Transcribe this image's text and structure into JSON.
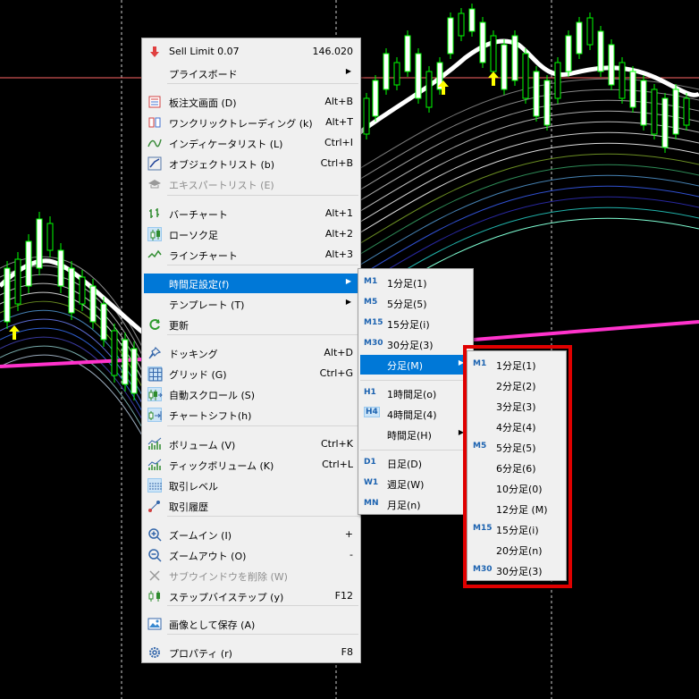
{
  "context_menu": {
    "header": {
      "label": "Sell Limit 0.07",
      "value": "146.020",
      "icon": "sell-arrow-icon"
    },
    "items": [
      {
        "label": "プライスボード",
        "shortcut": "",
        "arrow": true,
        "icon": "",
        "disabled": false
      },
      {
        "label": "板注文画面 (D)",
        "shortcut": "Alt+B",
        "icon": "depth-of-market-icon"
      },
      {
        "label": "ワンクリックトレーディング (k)",
        "shortcut": "Alt+T",
        "icon": "one-click-trading-icon"
      },
      {
        "label": "インディケータリスト (L)",
        "shortcut": "Ctrl+I",
        "icon": "indicator-list-icon"
      },
      {
        "label": "オブジェクトリスト (b)",
        "shortcut": "Ctrl+B",
        "icon": "object-list-icon"
      },
      {
        "label": "エキスパートリスト (E)",
        "shortcut": "",
        "icon": "expert-hat-icon",
        "disabled": true
      },
      {
        "label": "バーチャート",
        "shortcut": "Alt+1",
        "icon": "bar-chart-icon"
      },
      {
        "label": "ローソク足",
        "shortcut": "Alt+2",
        "icon": "candlestick-icon"
      },
      {
        "label": "ラインチャート",
        "shortcut": "Alt+3",
        "icon": "line-chart-icon"
      },
      {
        "label": "時間足設定(f)",
        "shortcut": "",
        "arrow": true,
        "icon": "",
        "highlighted": true
      },
      {
        "label": "テンプレート (T)",
        "shortcut": "",
        "arrow": true,
        "icon": ""
      },
      {
        "label": "更新",
        "shortcut": "",
        "icon": "refresh-icon"
      },
      {
        "label": "ドッキング",
        "shortcut": "Alt+D",
        "icon": "pin-icon"
      },
      {
        "label": "グリッド (G)",
        "shortcut": "Ctrl+G",
        "icon": "grid-icon"
      },
      {
        "label": "自動スクロール (S)",
        "shortcut": "",
        "icon": "auto-scroll-icon"
      },
      {
        "label": "チャートシフト(h)",
        "shortcut": "",
        "icon": "chart-shift-icon"
      },
      {
        "label": "ボリューム (V)",
        "shortcut": "Ctrl+K",
        "icon": "volume-icon"
      },
      {
        "label": "ティックボリューム (K)",
        "shortcut": "Ctrl+L",
        "icon": "tick-volume-icon"
      },
      {
        "label": "取引レベル",
        "shortcut": "",
        "icon": "trade-levels-icon"
      },
      {
        "label": "取引履歴",
        "shortcut": "",
        "icon": "trade-history-icon"
      },
      {
        "label": "ズームイン (I)",
        "shortcut": "+",
        "icon": "zoom-in-icon"
      },
      {
        "label": "ズームアウト (O)",
        "shortcut": "-",
        "icon": "zoom-out-icon"
      },
      {
        "label": "サブウインドウを削除 (W)",
        "shortcut": "",
        "icon": "close-icon",
        "disabled": true
      },
      {
        "label": "ステップバイステップ (y)",
        "shortcut": "F12",
        "icon": "step-icon"
      },
      {
        "label": "画像として保存 (A)",
        "shortcut": "",
        "icon": "image-icon"
      },
      {
        "label": "プロパティ (r)",
        "shortcut": "F8",
        "icon": "settings-gear-icon"
      }
    ]
  },
  "timeframe_menu": {
    "items": [
      {
        "tag": "M1",
        "label": "1分足(1)"
      },
      {
        "tag": "M5",
        "label": "5分足(5)"
      },
      {
        "tag": "M15",
        "label": "15分足(i)"
      },
      {
        "tag": "M30",
        "label": "30分足(3)"
      },
      {
        "tag": "",
        "label": "分足(M)",
        "arrow": true,
        "highlighted": true
      },
      {
        "tag": "H1",
        "label": "1時間足(o)"
      },
      {
        "tag": "H4",
        "label": "4時間足(4)",
        "boxed": true
      },
      {
        "tag": "",
        "label": "時間足(H)",
        "arrow": true
      },
      {
        "tag": "D1",
        "label": "日足(D)"
      },
      {
        "tag": "W1",
        "label": "週足(W)"
      },
      {
        "tag": "MN",
        "label": "月足(n)"
      }
    ]
  },
  "minutes_menu": {
    "items": [
      {
        "tag": "M1",
        "label": "1分足(1)"
      },
      {
        "tag": "",
        "label": "2分足(2)"
      },
      {
        "tag": "",
        "label": "3分足(3)"
      },
      {
        "tag": "",
        "label": "4分足(4)"
      },
      {
        "tag": "M5",
        "label": "5分足(5)"
      },
      {
        "tag": "",
        "label": "6分足(6)"
      },
      {
        "tag": "",
        "label": "10分足(0)"
      },
      {
        "tag": "",
        "label": "12分足 (M)"
      },
      {
        "tag": "M15",
        "label": "15分足(i)"
      },
      {
        "tag": "",
        "label": "20分足(n)"
      },
      {
        "tag": "M30",
        "label": "30分足(3)"
      }
    ]
  },
  "colors": {
    "menu_bg": "#f0f0f0",
    "highlight": "#0078d7",
    "annotation_border": "#e00000",
    "ma_main": "#ffffff",
    "ma_magenta": "#ff33cc",
    "signal_arrow": "#ffff00",
    "bull_candle": "#00ff00",
    "price_line": "#ff6666"
  }
}
